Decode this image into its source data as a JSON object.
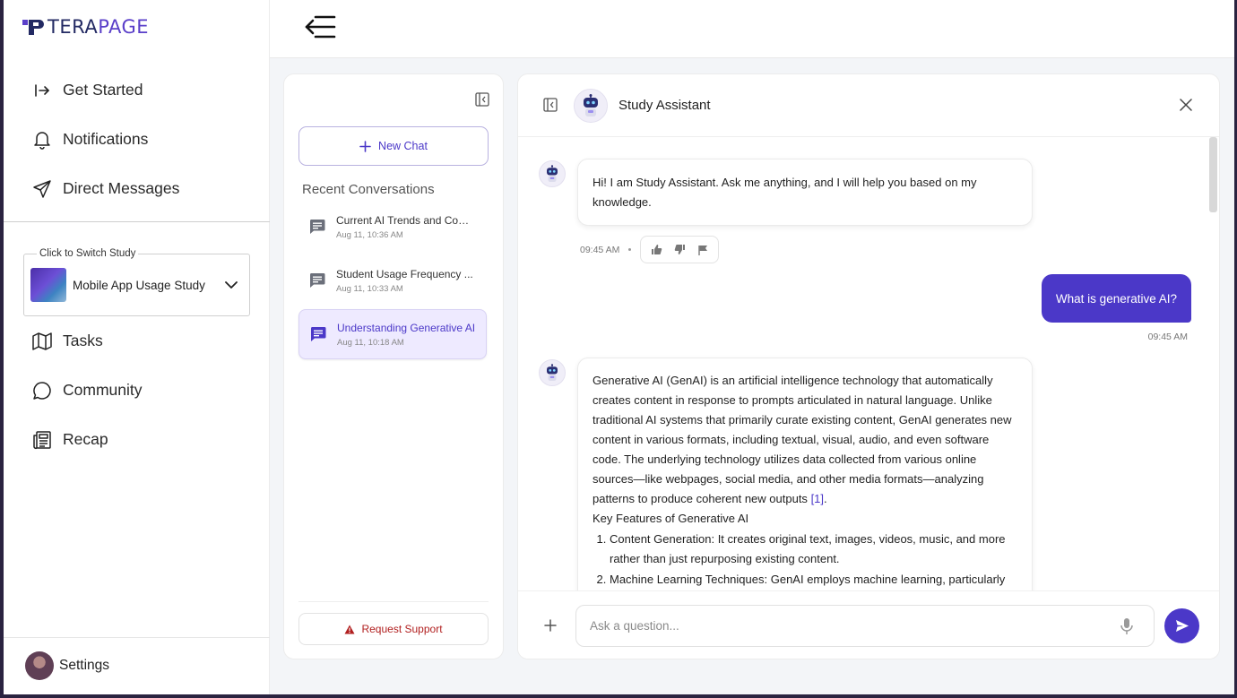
{
  "brand": {
    "name_part1": "TERA",
    "name_part2": "PAGE"
  },
  "sidebar": {
    "nav_top": [
      {
        "label": "Get Started",
        "icon": "login-arrow-icon"
      },
      {
        "label": "Notifications",
        "icon": "bell-icon"
      },
      {
        "label": "Direct Messages",
        "icon": "send-icon"
      }
    ],
    "study_switcher": {
      "caption": "Click to Switch Study",
      "selected": "Mobile App Usage Study"
    },
    "nav_bottom": [
      {
        "label": "Tasks",
        "icon": "map-icon"
      },
      {
        "label": "Community",
        "icon": "chat-bubble-icon"
      },
      {
        "label": "Recap",
        "icon": "newspaper-icon"
      }
    ],
    "settings_label": "Settings"
  },
  "conversations": {
    "new_chat_label": "New Chat",
    "recent_title": "Recent Conversations",
    "items": [
      {
        "title": "Current AI Trends and Com...",
        "date": "Aug 11, 10:36 AM",
        "active": false
      },
      {
        "title": "Student Usage Frequency ...",
        "date": "Aug 11, 10:33 AM",
        "active": false
      },
      {
        "title": "Understanding Generative AI",
        "date": "Aug 11, 10:18 AM",
        "active": true
      }
    ],
    "support_label": "Request Support"
  },
  "chat": {
    "title": "Study Assistant",
    "messages": {
      "greeting": {
        "text": "Hi! I am Study Assistant. Ask me anything, and I will help you based on my knowledge.",
        "time": "09:45 AM"
      },
      "user_question": {
        "text": "What is generative AI?",
        "time": "09:45 AM"
      },
      "answer": {
        "paragraph": "Generative AI (GenAI) is an artificial intelligence technology that automatically creates content in response to prompts articulated in natural language. Unlike traditional AI systems that primarily curate existing content, GenAI generates new content in various formats, including textual, visual, audio, and even software code. The underlying technology utilizes data collected from various online sources—like webpages, social media, and other media formats—analyzing patterns to produce coherent new outputs",
        "citation": "[1]",
        "end_punct": ".",
        "features_heading": "Key Features of Generative AI",
        "features": [
          {
            "term": "Content Generation",
            "desc": ": It creates original text, images, videos, music, and more rather than just repurposing existing content."
          },
          {
            "term": "Machine Learning Techniques",
            "desc": ": GenAI employs machine learning, particularly"
          }
        ]
      }
    },
    "input_placeholder": "Ask a question...",
    "colors": {
      "accent": "#4b38c8",
      "danger": "#b11f1f"
    }
  }
}
